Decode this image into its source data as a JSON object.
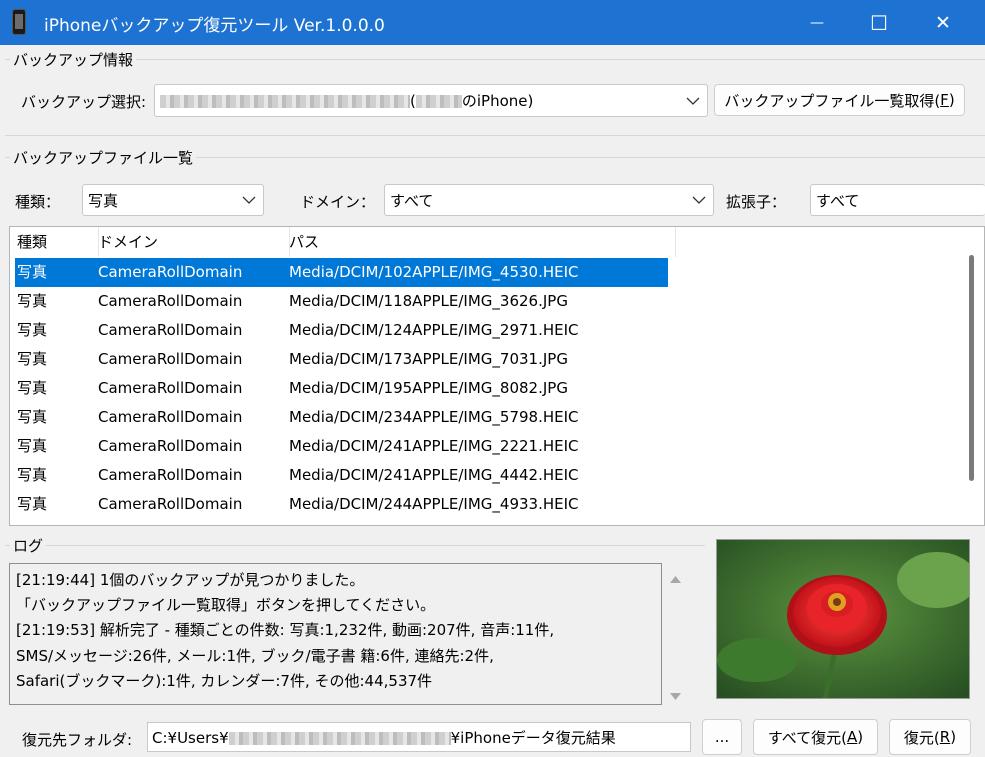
{
  "window": {
    "title": "iPhoneバックアップ復元ツール Ver.1.0.0.0",
    "minimize_glyph": "—",
    "maximize_glyph": "☐",
    "close_glyph": "✕"
  },
  "backup_info": {
    "group_label": "バックアップ情報",
    "select_label": "バックアップ選択:",
    "selected_value_paren": "(",
    "selected_value_suffix": "のiPhone)",
    "list_button_label": "バックアップファイル一覧取得(",
    "list_button_mnemonic": "F",
    "list_button_close": ")"
  },
  "file_list_group": {
    "group_label": "バックアップファイル一覧",
    "type_filter_label": "種類：",
    "type_filter_value": "写真",
    "domain_filter_label": "ドメイン：",
    "domain_filter_value": "すべて",
    "ext_filter_label": "拡張子：",
    "ext_filter_value": "すべて"
  },
  "table": {
    "columns": [
      "種類",
      "ドメイン",
      "パス"
    ],
    "rows": [
      {
        "type": "写真",
        "domain": "CameraRollDomain",
        "path": "Media/DCIM/102APPLE/IMG_4530.HEIC",
        "selected": true
      },
      {
        "type": "写真",
        "domain": "CameraRollDomain",
        "path": "Media/DCIM/118APPLE/IMG_3626.JPG"
      },
      {
        "type": "写真",
        "domain": "CameraRollDomain",
        "path": "Media/DCIM/124APPLE/IMG_2971.HEIC"
      },
      {
        "type": "写真",
        "domain": "CameraRollDomain",
        "path": "Media/DCIM/173APPLE/IMG_7031.JPG"
      },
      {
        "type": "写真",
        "domain": "CameraRollDomain",
        "path": "Media/DCIM/195APPLE/IMG_8082.JPG"
      },
      {
        "type": "写真",
        "domain": "CameraRollDomain",
        "path": "Media/DCIM/234APPLE/IMG_5798.HEIC"
      },
      {
        "type": "写真",
        "domain": "CameraRollDomain",
        "path": "Media/DCIM/241APPLE/IMG_2221.HEIC"
      },
      {
        "type": "写真",
        "domain": "CameraRollDomain",
        "path": "Media/DCIM/241APPLE/IMG_4442.HEIC"
      },
      {
        "type": "写真",
        "domain": "CameraRollDomain",
        "path": "Media/DCIM/244APPLE/IMG_4933.HEIC"
      }
    ]
  },
  "log": {
    "group_label": "ログ",
    "lines": [
      "[21:19:44] 1個のバックアップが見つかりました。",
      "「バックアップファイル一覧取得」ボタンを押してください。",
      "[21:19:53] 解析完了 - 種類ごとの件数: 写真:1,232件, 動画:207件, 音声:11件,",
      " SMS/メッセージ:26件, メール:1件, ブック/電子書 籍:6件, 連絡先:2件,",
      " Safari(ブックマーク):1件, カレンダー:7件, その他:44,537件"
    ]
  },
  "restore": {
    "folder_label": "復元先フォルダ:",
    "folder_value_prefix": "C:¥Users¥",
    "folder_value_suffix": "¥iPhoneデータ復元結果",
    "browse_label": "...",
    "restore_all_label": "すべて復元(",
    "restore_all_mnemonic": "A",
    "restore_label": "復元(",
    "restore_mnemonic": "R",
    "close_paren": ")"
  },
  "colors": {
    "titlebar": "#1e73d2",
    "selection": "#0078d7",
    "flower": "#e8242a"
  },
  "icons": [
    "iphone-icon",
    "chevron-down-icon",
    "scroll-up-icon",
    "scroll-down-icon"
  ]
}
